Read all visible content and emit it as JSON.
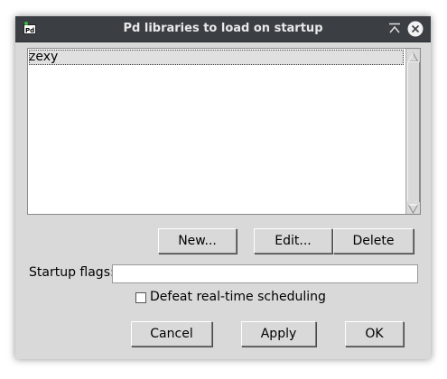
{
  "window": {
    "title": "Pd libraries to load on startup"
  },
  "titlebar": {
    "app_icon": "pd-app-icon",
    "buttons": [
      "minimize-icon",
      "close-icon"
    ]
  },
  "library_list": {
    "items": [
      "zexy"
    ],
    "selected_index": 0
  },
  "list_buttons": {
    "new": "New...",
    "edit": "Edit...",
    "delete": "Delete"
  },
  "startup_flags": {
    "label": "Startup flags:",
    "value": ""
  },
  "realtime": {
    "label": "Defeat real-time scheduling",
    "checked": false
  },
  "dialog_buttons": {
    "cancel": "Cancel",
    "apply": "Apply",
    "ok": "OK"
  }
}
